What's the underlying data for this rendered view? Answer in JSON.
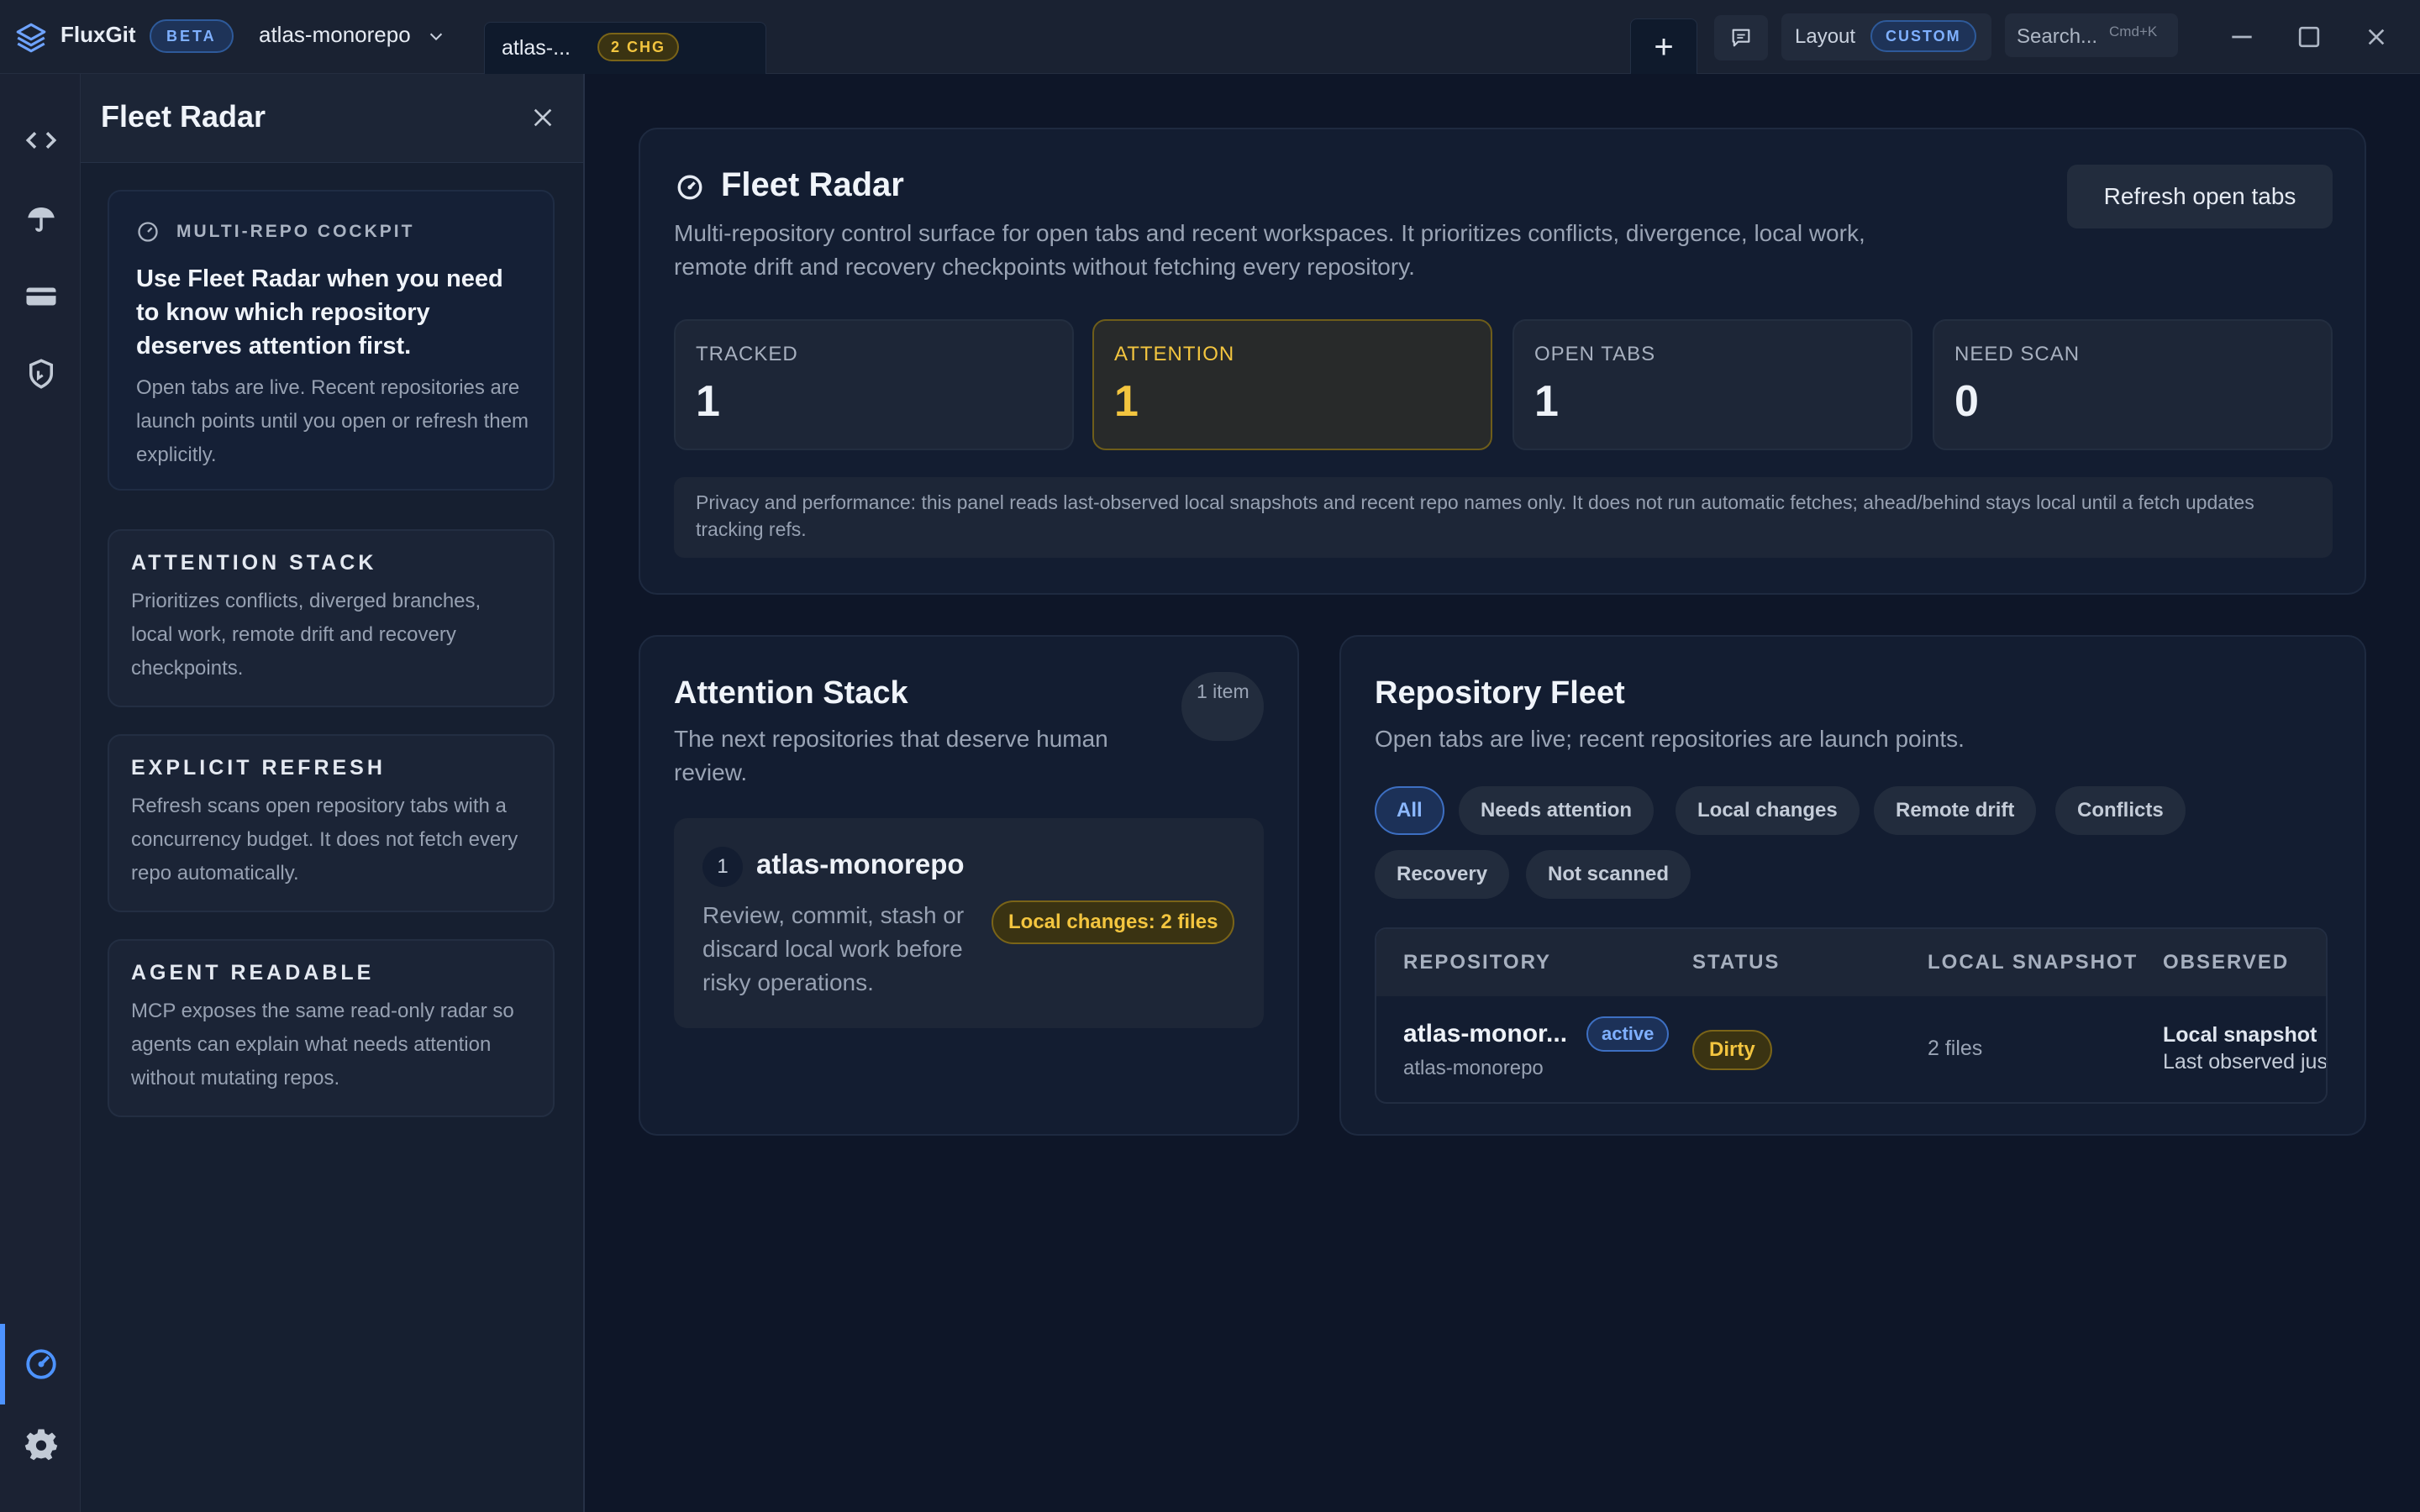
{
  "titlebar": {
    "app_name": "FluxGit",
    "beta_badge": "BETA",
    "repo_selector": "atlas-monorepo",
    "tab": {
      "label": "atlas-...",
      "badge": "2 CHG"
    },
    "new_tab": "+",
    "layout_label": "Layout",
    "layout_badge": "CUSTOM",
    "search_placeholder": "Search...",
    "search_shortcut": "Cmd+K"
  },
  "rail": {
    "icons": [
      "code-icon",
      "umbrella-icon",
      "card-icon",
      "shield-icon",
      "radar-icon",
      "gear-icon"
    ],
    "active": "radar-icon",
    "accent": "#4d93ff"
  },
  "sidebar": {
    "title": "Fleet Radar",
    "hero": {
      "kicker": "MULTI-REPO COCKPIT",
      "lead": "Use Fleet Radar when you need to know which repository deserves attention first.",
      "body": "Open tabs are live. Recent repositories are launch points until you open or refresh them explicitly."
    },
    "cards": [
      {
        "title": "ATTENTION STACK",
        "body": "Prioritizes conflicts, diverged branches, local work, remote drift and recovery checkpoints."
      },
      {
        "title": "EXPLICIT REFRESH",
        "body": "Refresh scans open repository tabs with a concurrency budget. It does not fetch every repo automatically."
      },
      {
        "title": "AGENT READABLE",
        "body": "MCP exposes the same read-only radar so agents can explain what needs attention without mutating repos."
      }
    ]
  },
  "fleet": {
    "title": "Fleet Radar",
    "description": "Multi-repository control surface for open tabs and recent workspaces. It prioritizes conflicts, divergence, local work, remote drift and recovery checkpoints without fetching every repository.",
    "refresh_button": "Refresh open tabs",
    "stats": [
      {
        "label": "TRACKED",
        "value": "1"
      },
      {
        "label": "ATTENTION",
        "value": "1"
      },
      {
        "label": "OPEN TABS",
        "value": "1"
      },
      {
        "label": "NEED SCAN",
        "value": "0"
      }
    ],
    "privacy_note": "Privacy and performance: this panel reads last-observed local snapshots and recent repo names only. It does not run automatic fetches; ahead/behind stays local until a fetch updates tracking refs."
  },
  "attention": {
    "title": "Attention Stack",
    "subtitle": "The next repositories that deserve human review.",
    "count": "1 item",
    "items": [
      {
        "rank": "1",
        "name": "atlas-monorepo",
        "description": "Review, commit, stash or discard local work before risky operations.",
        "badge": "Local changes: 2 files"
      }
    ]
  },
  "repo_fleet": {
    "title": "Repository Fleet",
    "subtitle": "Open tabs are live; recent repositories are launch points.",
    "filters": [
      "All",
      "Needs attention",
      "Local changes",
      "Remote drift",
      "Conflicts",
      "Recovery",
      "Not scanned"
    ],
    "active_filter": "All",
    "columns": [
      "REPOSITORY",
      "STATUS",
      "LOCAL SNAPSHOT",
      "OBSERVED"
    ],
    "rows": [
      {
        "name": "atlas-monor...",
        "subname": "atlas-monorepo",
        "tag": "active",
        "status": "Dirty",
        "snapshot": "2 files",
        "observed_title": "Local snapshot",
        "observed_detail": "Last observed jus"
      }
    ]
  },
  "colors": {
    "background": "#0e1628",
    "panel": "#131d31",
    "accent_blue": "#4d93ff",
    "warning_yellow": "#f3c53f"
  }
}
